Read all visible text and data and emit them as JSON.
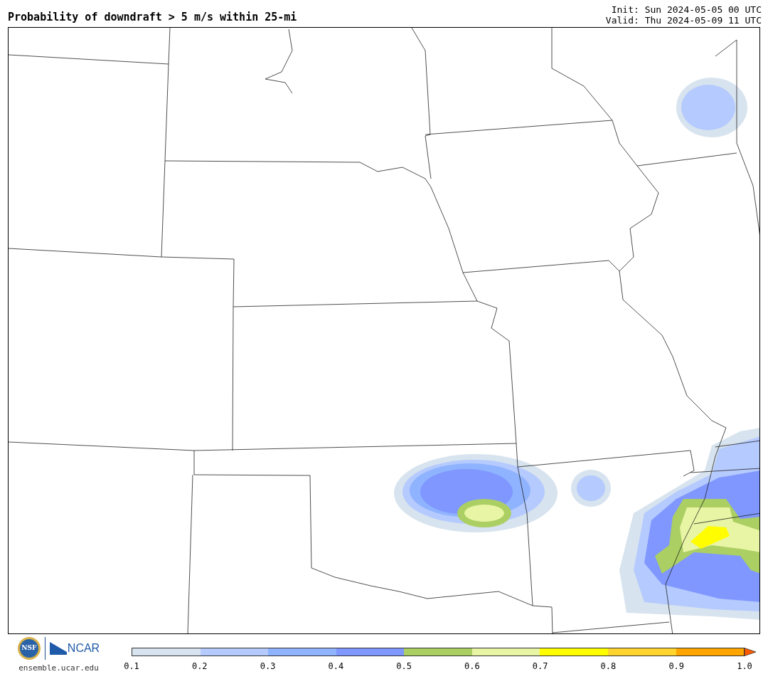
{
  "title": "Probability of downdraft > 5 m/s within 25-mi",
  "init": "Init: Sun 2024-05-05 00 UTC",
  "valid": "Valid: Thu 2024-05-09 11 UTC",
  "logos": {
    "nsf": "NSF",
    "ncar": "NCAR",
    "site": "ensemble.ucar.edu"
  },
  "colorbar": {
    "segments": [
      {
        "color": "#d7e3ee"
      },
      {
        "color": "#b5cafe"
      },
      {
        "color": "#8fb3ff"
      },
      {
        "color": "#7f97ff"
      },
      {
        "color": "#abcf63"
      },
      {
        "color": "#e8f5a4"
      },
      {
        "color": "#fffd00"
      },
      {
        "color": "#ffd42f"
      },
      {
        "color": "#ffa500"
      }
    ],
    "extension": {
      "color": "#ff5a00"
    },
    "ticks": [
      "0.1",
      "0.2",
      "0.3",
      "0.4",
      "0.5",
      "0.6",
      "0.7",
      "0.8",
      "0.9",
      "1.0"
    ]
  }
}
